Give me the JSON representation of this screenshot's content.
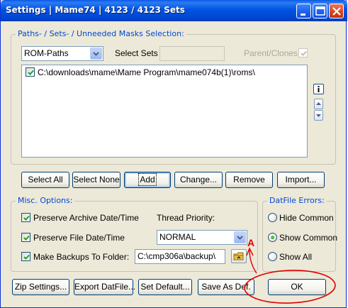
{
  "window": {
    "title": "Settings  |  Mame74  |  4123 / 4123 Sets"
  },
  "paths_group": {
    "legend": "Paths- / Sets- / Unneeded Masks Selection:",
    "path_type": "ROM-Paths",
    "select_sets_label": "Select Sets",
    "select_sets_value": "",
    "parent_clones_label": "Parent/Clones",
    "parent_clones_checked": true,
    "paths": [
      {
        "checked": true,
        "text": "C:\\downloads\\mame\\Mame Program\\mame074b(1)\\roms\\"
      }
    ],
    "info_icon": "info-icon",
    "up_icon": "arrow-up-icon",
    "down_icon": "arrow-down-icon"
  },
  "path_buttons": {
    "select_all": "Select All",
    "select_none": "Select None",
    "add": "Add",
    "change": "Change...",
    "remove": "Remove",
    "import": "Import..."
  },
  "misc": {
    "legend": "Misc. Options:",
    "preserve_archive_label": "Preserve Archive Date/Time",
    "preserve_archive_checked": true,
    "preserve_file_label": "Preserve File Date/Time",
    "preserve_file_checked": true,
    "make_backups_label": "Make Backups To Folder:",
    "make_backups_checked": true,
    "thread_priority_label": "Thread Priority:",
    "thread_priority_value": "NORMAL",
    "backup_folder": "C:\\cmp306a\\backup\\",
    "browse_icon": "folder-browse-icon"
  },
  "datfile_errors": {
    "legend": "DatFile Errors:",
    "options": [
      {
        "label": "Hide Common",
        "selected": false
      },
      {
        "label": "Show Common",
        "selected": true
      },
      {
        "label": "Show All",
        "selected": false
      }
    ]
  },
  "bottom_buttons": {
    "zip_settings": "Zip Settings...",
    "export_datfile": "Export DatFile...",
    "set_default": "Set Default...",
    "save_as_def": "Save As Def.",
    "ok": "OK"
  },
  "annotation": {
    "letter": "A",
    "color": "#e00000"
  },
  "colors": {
    "title_blue": "#0054e3",
    "window_bg": "#ece9d8",
    "legend_blue": "#0046d5",
    "annotation_red": "#e00000"
  }
}
